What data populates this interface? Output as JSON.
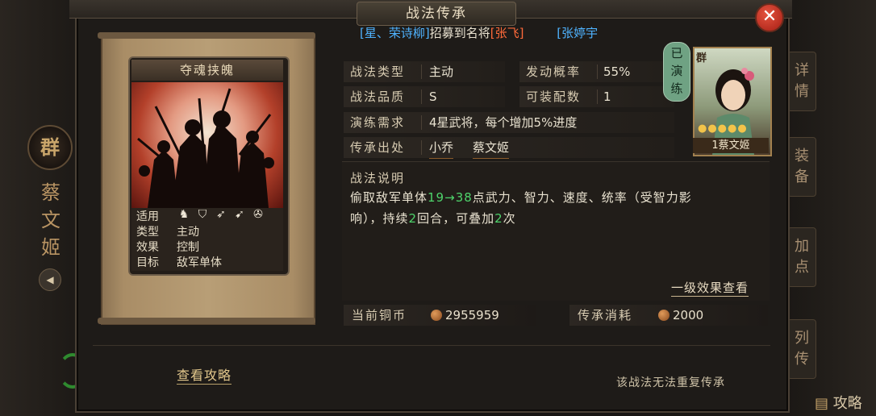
{
  "window": {
    "title": "战法传承",
    "close_label": "✕"
  },
  "ticker": {
    "part1": "[星、荣诗柳]",
    "part2": "招募到名将",
    "part3": "[张飞]",
    "part4": "[张婷宇"
  },
  "left_panel": {
    "faction": "群",
    "hero_name": "蔡文姬"
  },
  "right_tabs": [
    "详情",
    "装备",
    "加点",
    "列传"
  ],
  "bottom_right_label": "攻略",
  "card": {
    "title": "夺魂挟魄",
    "apply_label": "适用",
    "apply_icons": [
      "cavalry-icon",
      "shield-icon",
      "bow-icon",
      "spear-icon",
      "wheel-icon"
    ],
    "rows": [
      {
        "key": "类型",
        "value": "主动"
      },
      {
        "key": "效果",
        "value": "控制"
      },
      {
        "key": "目标",
        "value": "敌军单体"
      }
    ]
  },
  "info": {
    "type_label": "战法类型",
    "type_value": "主动",
    "prob_label": "发动概率",
    "prob_value": "55%",
    "quality_label": "战法品质",
    "quality_value": "S",
    "slots_label": "可装配数",
    "slots_value": "1",
    "req_label": "演练需求",
    "req_value": "4星武将，每个增加5%进度",
    "source_label": "传承出处",
    "source_1": "小乔",
    "source_2": "蔡文姬"
  },
  "description": {
    "title": "战法说明",
    "line1_a": "偷取敌军单体",
    "range_lo": "19",
    "arrow": "→",
    "range_hi": "38",
    "line1_b": "点武力、智力、速度、统率（受智力影",
    "line2_a": "响），持续",
    "turns": "2",
    "line2_b": "回合，可叠加",
    "stacks": "2",
    "line2_c": "次",
    "level_link": "一级效果查看"
  },
  "costs": {
    "coins_label": "当前铜币",
    "coins_value": "2955959",
    "cost_label": "传承消耗",
    "cost_value": "2000"
  },
  "footer": {
    "guide_link": "查看攻略",
    "note": "该战法无法重复传承"
  },
  "hero": {
    "badge": "已演练",
    "faction": "群",
    "stars": "●●●●●",
    "name_label": "1蔡文姬"
  }
}
